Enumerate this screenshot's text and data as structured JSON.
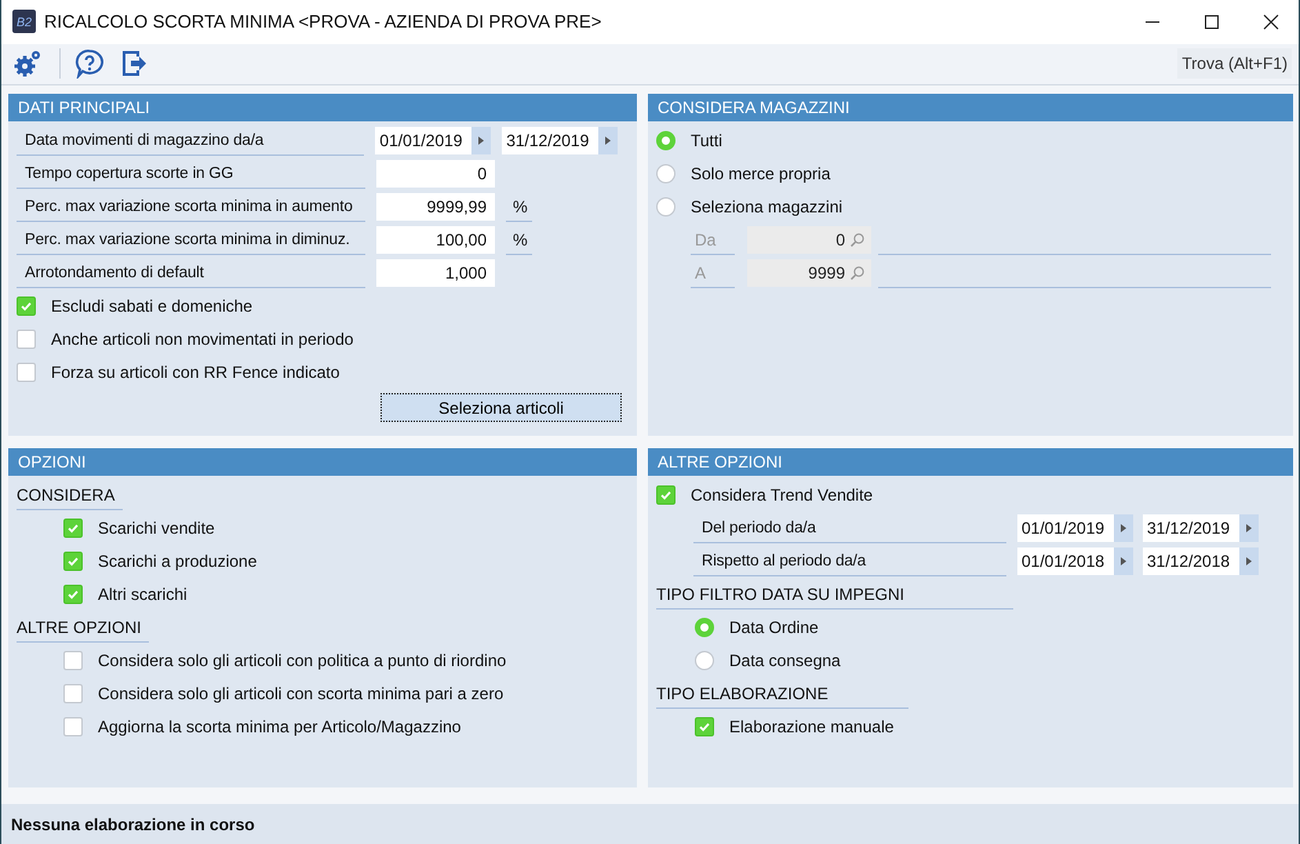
{
  "window": {
    "logo": "B2",
    "title": "RICALCOLO SCORTA MINIMA <PROVA - AZIENDA DI PROVA PRE>"
  },
  "toolbar": {
    "search_button": "Trova (Alt+F1)"
  },
  "main": {
    "title": "DATI PRINCIPALI",
    "date_range": {
      "label": "Data movimenti di magazzino da/a",
      "from": "01/01/2019",
      "to": "31/12/2019"
    },
    "fields": [
      {
        "label": "Tempo copertura scorte in GG",
        "value": "0"
      },
      {
        "label": "Perc. max variazione scorta minima in aumento",
        "value": "9999,99",
        "unit": "%"
      },
      {
        "label": "Perc. max variazione scorta minima in diminuz.",
        "value": "100,00",
        "unit": "%"
      },
      {
        "label": "Arrotondamento di default",
        "value": "1,000"
      }
    ],
    "checkboxes": [
      {
        "label": "Escludi sabati e domeniche",
        "checked": true
      },
      {
        "label": "Anche articoli non movimentati in periodo",
        "checked": false
      },
      {
        "label": "Forza su articoli con RR Fence indicato",
        "checked": false
      }
    ],
    "button": "Seleziona articoli"
  },
  "warehouses": {
    "title": "CONSIDERA MAGAZZINI",
    "options": [
      {
        "label": "Tutti",
        "selected": true
      },
      {
        "label": "Solo merce propria",
        "selected": false
      },
      {
        "label": "Seleziona magazzini",
        "selected": false
      }
    ],
    "range": [
      {
        "label": "Da",
        "value": "0",
        "disabled": true
      },
      {
        "label": "A",
        "value": "9999",
        "disabled": true
      }
    ]
  },
  "options": {
    "title": "OPZIONI",
    "groups": [
      {
        "title": "CONSIDERA",
        "items": [
          {
            "label": "Scarichi vendite",
            "checked": true
          },
          {
            "label": "Scarichi a produzione",
            "checked": true
          },
          {
            "label": "Altri scarichi",
            "checked": true
          }
        ]
      },
      {
        "title": "ALTRE OPZIONI",
        "items": [
          {
            "label": "Considera solo gli articoli con politica a punto di riordino",
            "checked": false
          },
          {
            "label": "Considera solo gli articoli con scorta minima pari a zero",
            "checked": false
          },
          {
            "label": "Aggiorna la scorta minima per Articolo/Magazzino",
            "checked": false
          }
        ]
      }
    ]
  },
  "other_options": {
    "title": "ALTRE OPZIONI",
    "trend": {
      "label": "Considera Trend Vendite",
      "checked": true
    },
    "periods": [
      {
        "label": "Del periodo da/a",
        "from": "01/01/2019",
        "to": "31/12/2019"
      },
      {
        "label": "Rispetto al periodo da/a",
        "from": "01/01/2018",
        "to": "31/12/2018"
      }
    ],
    "date_filter": {
      "title": "TIPO FILTRO DATA SU IMPEGNI",
      "options": [
        {
          "label": "Data Ordine",
          "selected": true
        },
        {
          "label": "Data consegna",
          "selected": false
        }
      ]
    },
    "processing": {
      "title": "TIPO ELABORAZIONE",
      "items": [
        {
          "label": "Elaborazione manuale",
          "checked": true
        }
      ]
    }
  },
  "status_bar": "Nessuna elaborazione in corso"
}
